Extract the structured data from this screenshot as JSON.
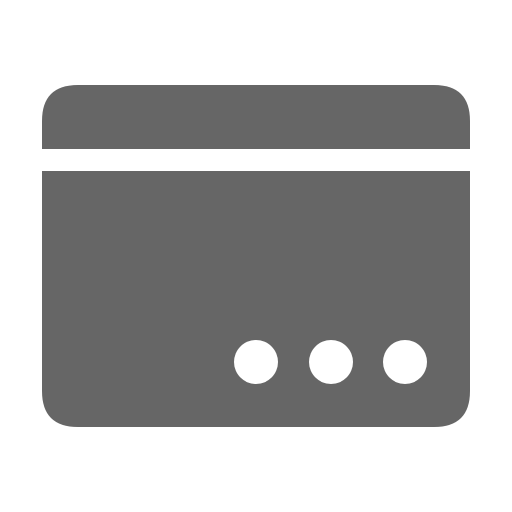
{
  "icon": {
    "name": "browser-window-more-icon",
    "color": "#666666",
    "cutout_color": "#ffffff"
  }
}
